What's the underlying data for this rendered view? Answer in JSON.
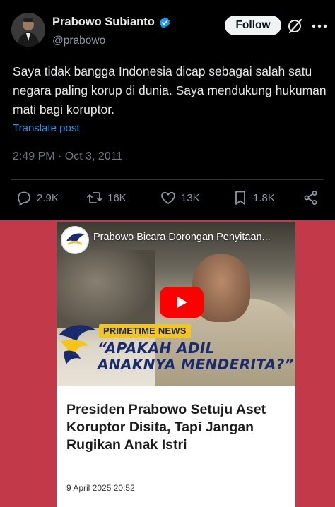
{
  "tweet": {
    "author_name": "Prabowo Subianto",
    "handle": "@prabowo",
    "follow_label": "Follow",
    "text": "Saya tidak bangga Indonesia dicap sebagai salah satu negara paling korup di dunia. Saya mendukung hukuman mati bagi koruptor.",
    "translate_label": "Translate post",
    "timestamp": "2:49 PM · Oct 3, 2011",
    "actions": {
      "replies": "2.9K",
      "reposts": "16K",
      "likes": "13K",
      "bookmarks": "1.8K"
    },
    "colors": {
      "verified": "#1d9bf0",
      "link": "#1d9bf0"
    }
  },
  "article_card": {
    "video_title": "Prabowo Bicara Dorongan Penyitaan...",
    "badge": "PRIMETIME NEWS",
    "headline_line1": "“APAKAH ADIL",
    "headline_line2": "ANAKNYA MENDERITA?”",
    "article_title": "Presiden Prabowo Setuju Aset Koruptor Disita, Tapi Jangan Rugikan Anak Istri",
    "date": "9 April 2025 20:52",
    "colors": {
      "background": "#c23a4a",
      "play": "#ff0000",
      "badge": "#f5c518",
      "headline": "#1a2a6e"
    }
  }
}
